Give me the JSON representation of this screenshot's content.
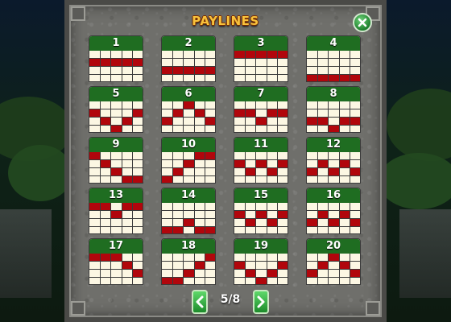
{
  "title": "PAYLINES",
  "page_indicator": "5/8",
  "icons": {
    "close": "close-icon",
    "prev": "chevron-left-icon",
    "next": "chevron-right-icon"
  },
  "colors": {
    "header_green": "#1f6d21",
    "active_cell": "#b1060c",
    "cell_bg": "#fcf7e3",
    "title_gold": "#f7c23c"
  },
  "paylines": [
    {
      "number": "1",
      "rows": [
        1,
        1,
        1,
        1,
        1
      ]
    },
    {
      "number": "2",
      "rows": [
        2,
        2,
        2,
        2,
        2
      ]
    },
    {
      "number": "3",
      "rows": [
        0,
        0,
        0,
        0,
        0
      ]
    },
    {
      "number": "4",
      "rows": [
        3,
        3,
        3,
        3,
        3
      ]
    },
    {
      "number": "5",
      "rows": [
        1,
        2,
        3,
        2,
        1
      ]
    },
    {
      "number": "6",
      "rows": [
        2,
        1,
        0,
        1,
        2
      ]
    },
    {
      "number": "7",
      "rows": [
        1,
        1,
        2,
        1,
        1
      ]
    },
    {
      "number": "8",
      "rows": [
        2,
        2,
        3,
        2,
        2
      ]
    },
    {
      "number": "9",
      "rows": [
        0,
        1,
        2,
        3,
        3
      ]
    },
    {
      "number": "10",
      "rows": [
        3,
        2,
        1,
        0,
        0
      ]
    },
    {
      "number": "11",
      "rows": [
        1,
        2,
        1,
        2,
        1
      ]
    },
    {
      "number": "12",
      "rows": [
        2,
        1,
        2,
        1,
        2
      ]
    },
    {
      "number": "13",
      "rows": [
        0,
        0,
        1,
        0,
        0
      ]
    },
    {
      "number": "14",
      "rows": [
        3,
        3,
        2,
        3,
        3
      ]
    },
    {
      "number": "15",
      "rows": [
        1,
        2,
        1,
        2,
        1
      ]
    },
    {
      "number": "16",
      "rows": [
        2,
        1,
        2,
        1,
        2
      ]
    },
    {
      "number": "17",
      "rows": [
        0,
        0,
        0,
        1,
        2
      ]
    },
    {
      "number": "18",
      "rows": [
        3,
        3,
        2,
        1,
        0
      ]
    },
    {
      "number": "19",
      "rows": [
        1,
        2,
        3,
        2,
        1
      ]
    },
    {
      "number": "20",
      "rows": [
        2,
        1,
        0,
        1,
        2
      ]
    }
  ]
}
